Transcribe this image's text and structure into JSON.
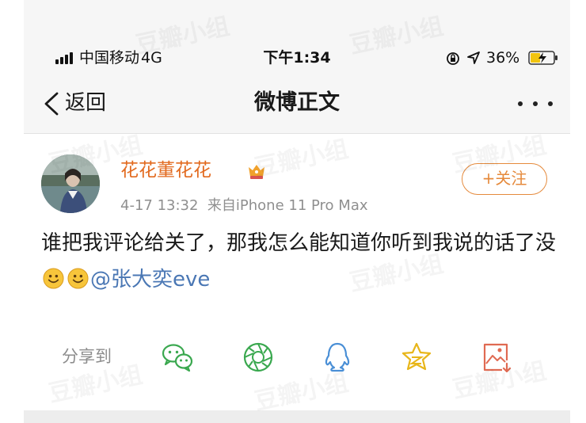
{
  "status_bar": {
    "carrier": "中国移动",
    "network": "4G",
    "time": "下午1:34",
    "battery_percent": "36%",
    "icons": [
      "signal-icon",
      "orientation-lock-icon",
      "location-icon",
      "battery-charging-icon"
    ]
  },
  "nav": {
    "back_label": "返回",
    "title": "微博正文",
    "icons": [
      "back-chevron-icon",
      "more-icon"
    ]
  },
  "post": {
    "username": "花花董花花",
    "timestamp": "4-17 13:32",
    "source": "来自iPhone 11 Pro Max",
    "follow_label": "+关注",
    "text": "谁把我评论给关了，那我怎么能知道你听到我说的话了没",
    "mention": "@张大奕eve",
    "emoji_count": 2
  },
  "share": {
    "label": "分享到",
    "targets": [
      "wechat-icon",
      "moments-icon",
      "qq-icon",
      "qzone-icon",
      "save-image-icon"
    ]
  },
  "watermark": "豆瓣小组",
  "colors": {
    "username": "#e26a1f",
    "follow": "#e58a3c",
    "mention": "#4a77b4",
    "share_icons": "#3aa84f",
    "qq_icon": "#4a8fd6",
    "qzone_icon": "#e8b61a",
    "save_icon": "#e06a52"
  }
}
